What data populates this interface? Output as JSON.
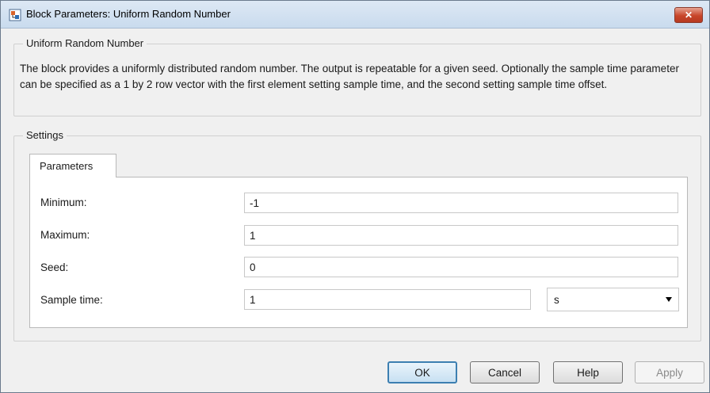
{
  "window": {
    "title": "Block Parameters: Uniform Random Number",
    "close_label": "✕"
  },
  "block": {
    "header": "Uniform Random Number",
    "description": "The block provides a uniformly distributed random number. The output is repeatable for a given seed. Optionally the sample time parameter can be specified as a 1 by 2 row vector with the first element setting sample time, and the second setting sample time offset."
  },
  "settings": {
    "header": "Settings",
    "tab_label": "Parameters",
    "params": {
      "minimum": {
        "label": "Minimum:",
        "value": "-1"
      },
      "maximum": {
        "label": "Maximum:",
        "value": "1"
      },
      "seed": {
        "label": "Seed:",
        "value": "0"
      },
      "sample_time": {
        "label": "Sample time:",
        "value": "1",
        "unit": "s"
      }
    }
  },
  "buttons": {
    "ok": "OK",
    "cancel": "Cancel",
    "help": "Help",
    "apply": "Apply"
  },
  "icons": {
    "app": "simulink-block-icon",
    "close": "close-icon",
    "dropdown": "chevron-down-icon"
  },
  "colors": {
    "close_button": "#c8452a",
    "default_button_border": "#3c7fb1"
  }
}
